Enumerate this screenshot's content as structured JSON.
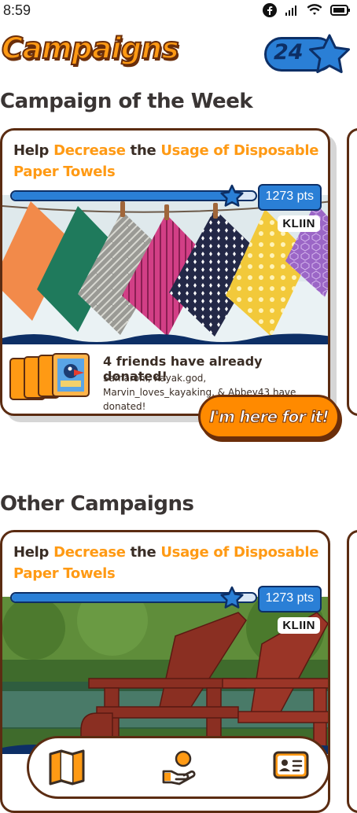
{
  "status_bar": {
    "time": "8:59"
  },
  "header": {
    "title": "Campaigns",
    "points": "24"
  },
  "featured": {
    "section_title": "Campaign of the Week",
    "headline": {
      "prefix": "Help ",
      "word1": "Decrease",
      "mid": " the ",
      "word2": "Usage of  Disposable",
      "word3": "Paper Towels"
    },
    "progress": 0.9,
    "points_label": "1273 pts",
    "brand": "KLIIN",
    "donated_title": "4 friends have already donated!",
    "donated_names": "Samaroni, Kayak.god, Marvin_loves_kayaking, & Abbey43 have donated!",
    "cta_label": "I'm here for it!"
  },
  "others": {
    "section_title": "Other Campaigns",
    "headline": {
      "prefix": "Help ",
      "word1": "Decrease",
      "mid": " the ",
      "word2": "Usage of  Disposable",
      "word3": "Paper Towels"
    },
    "progress": 0.9,
    "points_label": "1273 pts",
    "brand": "KLIIN"
  },
  "bottom_nav": {
    "items": [
      {
        "icon": "map-icon"
      },
      {
        "icon": "donate-hand-icon"
      },
      {
        "icon": "profile-card-icon"
      }
    ]
  },
  "colors": {
    "accent": "#ff9a14",
    "brand_dark": "#5b2c12",
    "blue": "#2a7fd6"
  }
}
